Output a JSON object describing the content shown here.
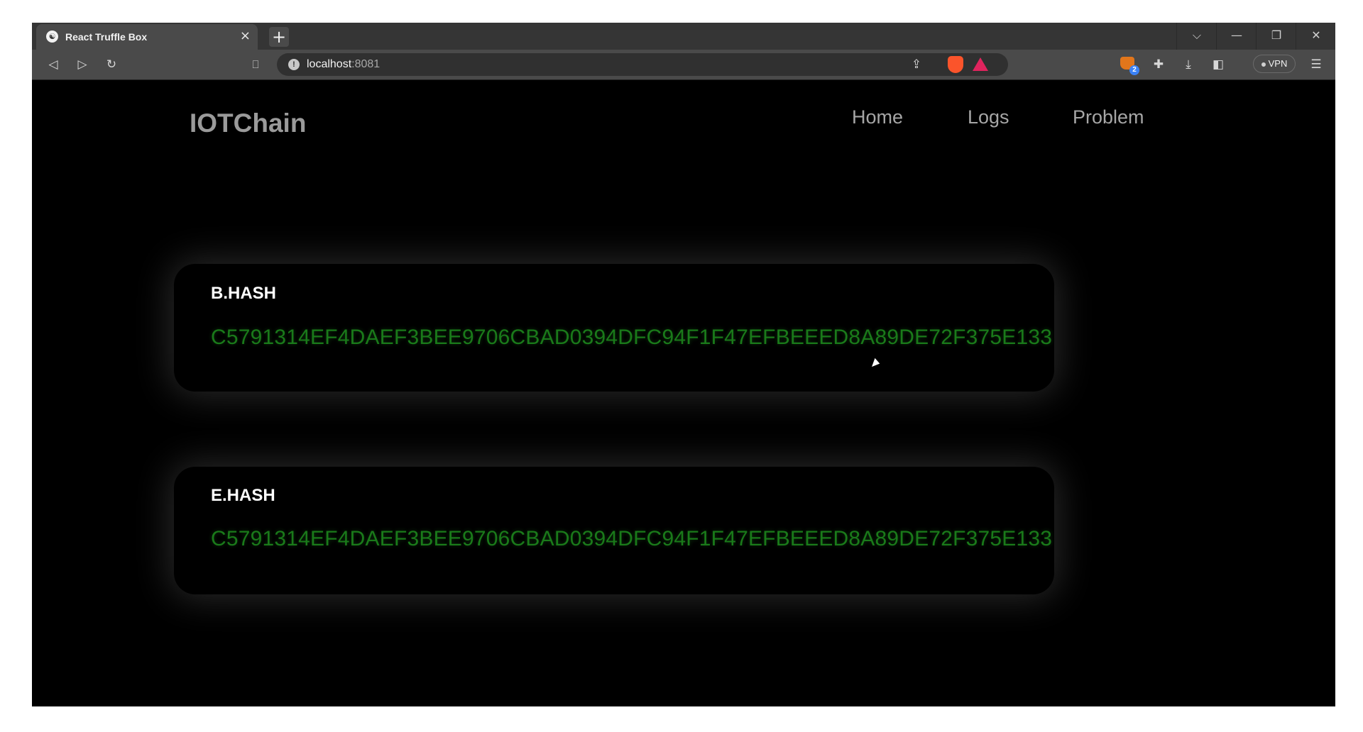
{
  "browser": {
    "tab_title": "React Truffle Box",
    "tab_close": "×",
    "new_tab": "+",
    "url_host": "localhost",
    "url_port": ":8081",
    "vpn_label": "VPN",
    "extension_badge": "2",
    "window_controls": {
      "dropdown": "⌵",
      "minimize": "—",
      "restore": "❐",
      "close": "✕"
    },
    "nav": {
      "back": "◁",
      "forward": "▷",
      "reload": "↻",
      "bookmark": "🔖"
    }
  },
  "app": {
    "brand": "IOTChain",
    "nav": [
      "Home",
      "Logs",
      "Problem"
    ]
  },
  "hashes": [
    {
      "label": "B.HASH",
      "value": "C5791314EF4DAEF3BEE9706CBAD0394DFC94F1F47EFBEEED8A89DE72F375E133"
    },
    {
      "label": "E.HASH",
      "value": "C5791314EF4DAEF3BEE9706CBAD0394DFC94F1F47EFBEEED8A89DE72F375E133"
    }
  ],
  "colors": {
    "hash_value": "#1a7a1a",
    "background": "#000000",
    "nav_text": "#a6a6a6"
  }
}
